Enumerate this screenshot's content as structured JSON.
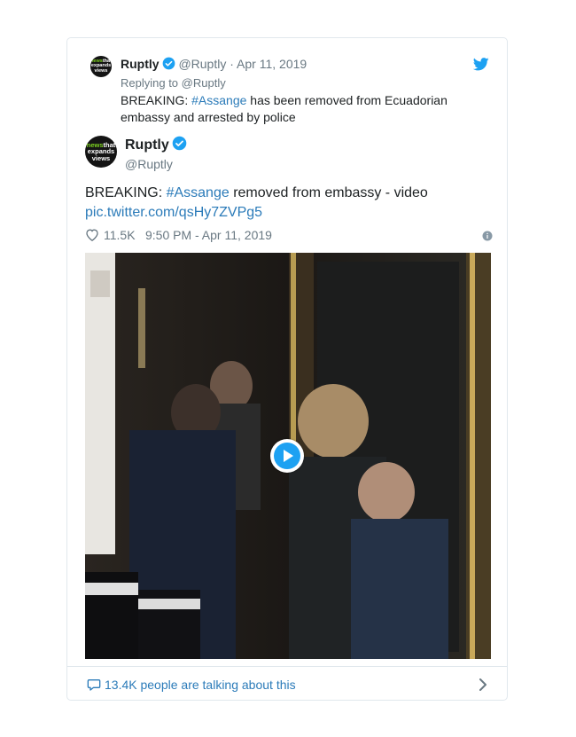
{
  "quoted": {
    "avatar_icon": "newsthat-expands-views-logo",
    "name": "Ruptly",
    "handle": "@Ruptly",
    "separator": "·",
    "date": "Apr 11, 2019",
    "replying_label": "Replying to",
    "replying_handle": "@Ruptly",
    "text_prefix": "BREAKING: ",
    "hashtag": "#Assange",
    "text_suffix": " has been removed from Ecuadorian embassy and arrested by police"
  },
  "main": {
    "avatar_icon": "newsthat-expands-views-logo",
    "name": "Ruptly",
    "handle": "@Ruptly",
    "text_prefix": "BREAKING: ",
    "hashtag": "#Assange",
    "text_suffix": " removed from embassy - video",
    "link": "pic.twitter.com/qsHy7ZVPg5",
    "likes": "11.5K",
    "time": "9:50 PM - Apr 11, 2019"
  },
  "logo": {
    "line1": "news",
    "line1b": "that",
    "line2": "expands",
    "line3": "views"
  },
  "footer": {
    "talking": "13.4K people are talking about this"
  },
  "colors": {
    "link": "#2b7bb9",
    "verified": "#1da1f2",
    "muted": "#697882",
    "border": "#e1e8ed"
  }
}
